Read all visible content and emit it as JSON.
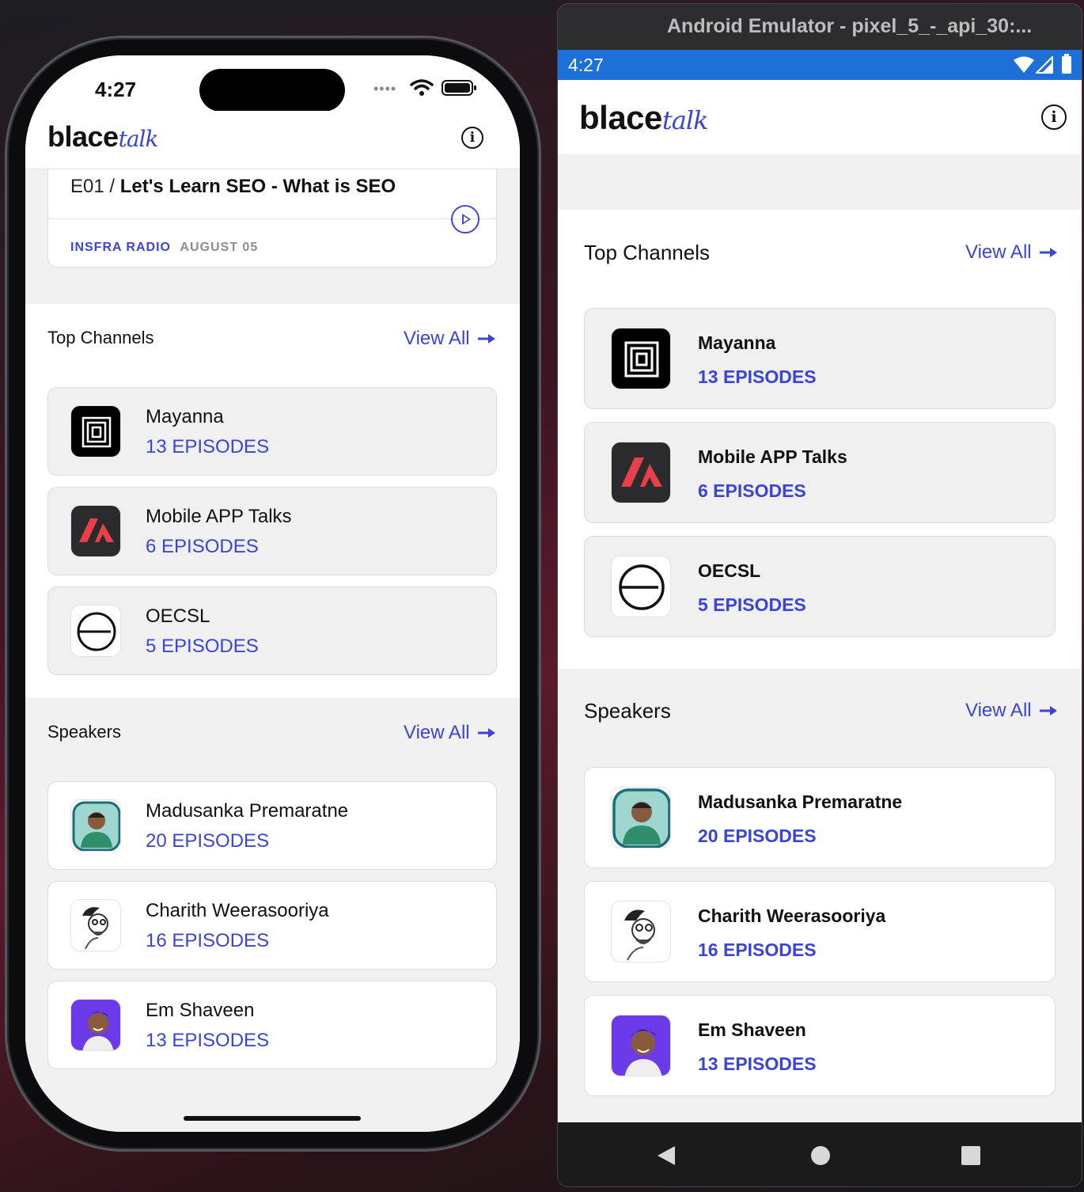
{
  "emulator": {
    "title": "Android Emulator - pixel_5_-_api_30:..."
  },
  "ios": {
    "status": {
      "time": "4:27"
    },
    "header": {
      "logo_main": "blace",
      "logo_accent": "talk"
    },
    "episode": {
      "code": "E01 / ",
      "title": "Let's Learn SEO - What is SEO",
      "source": "INSFRA RADIO",
      "date": "AUGUST 05"
    }
  },
  "android": {
    "status": {
      "time": "4:27"
    },
    "header": {
      "logo_main": "blace",
      "logo_accent": "talk"
    }
  },
  "top_channels": {
    "title": "Top Channels",
    "view_all": "View All",
    "items": [
      {
        "name": "Mayanna",
        "episodes": "13 EPISODES",
        "icon": "mayanna-logo-icon"
      },
      {
        "name": "Mobile APP Talks",
        "episodes": "6 EPISODES",
        "icon": "mobile-app-talks-logo-icon"
      },
      {
        "name": "OECSL",
        "episodes": "5 EPISODES",
        "icon": "oecsl-logo-icon"
      }
    ]
  },
  "speakers": {
    "title": "Speakers",
    "view_all": "View All",
    "items": [
      {
        "name": "Madusanka Premaratne",
        "episodes": "20 EPISODES"
      },
      {
        "name": "Charith Weerasooriya",
        "episodes": "16 EPISODES"
      },
      {
        "name": "Em Shaveen",
        "episodes": "13 EPISODES"
      }
    ]
  },
  "colors": {
    "accent": "#3b44d9",
    "android_status": "#1e70d9"
  }
}
